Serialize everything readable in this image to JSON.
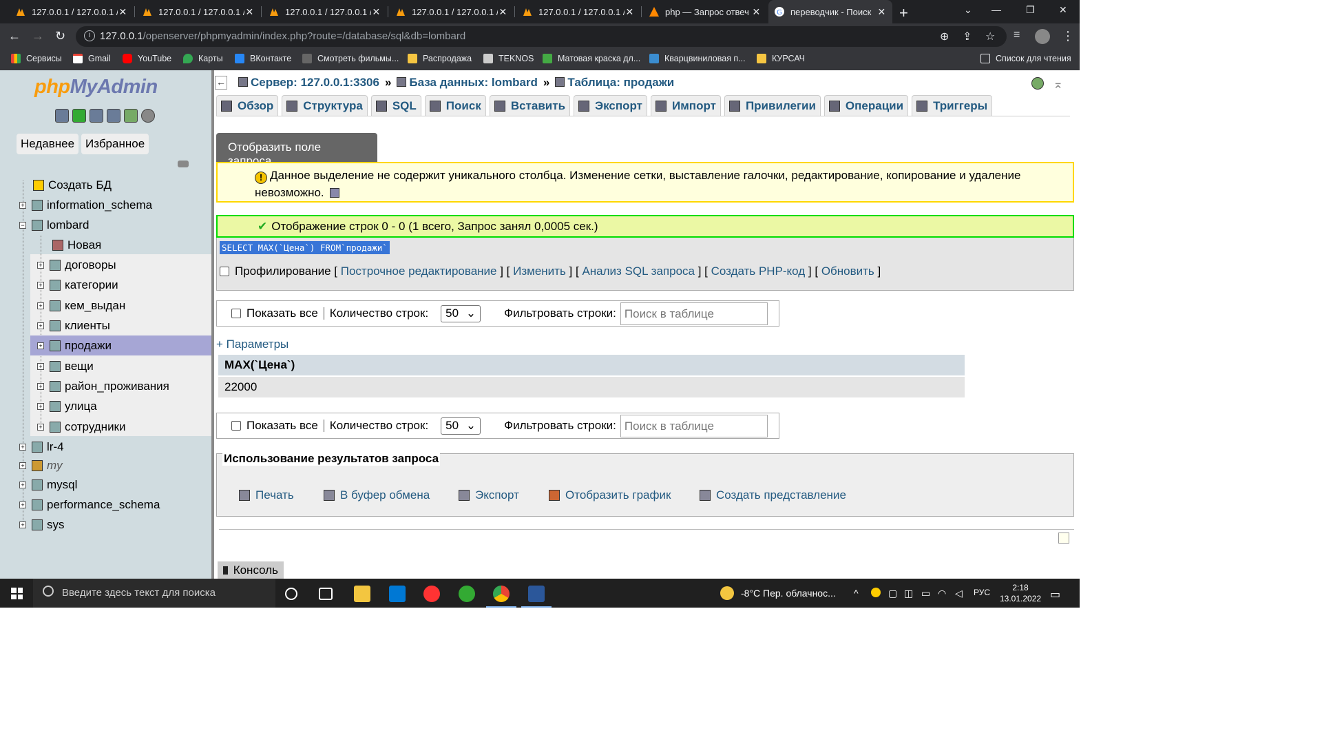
{
  "browser": {
    "tabs": [
      {
        "title": "127.0.0.1 / 127.0.0.1 /",
        "close": "✕"
      },
      {
        "title": "127.0.0.1 / 127.0.0.1 /",
        "close": "✕"
      },
      {
        "title": "127.0.0.1 / 127.0.0.1 /",
        "close": "✕"
      },
      {
        "title": "127.0.0.1 / 127.0.0.1 /",
        "close": "✕"
      },
      {
        "title": "127.0.0.1 / 127.0.0.1 /",
        "close": "✕"
      },
      {
        "title": "php — Запрос отвеч",
        "close": "✕"
      },
      {
        "title": "переводчик - Поиск",
        "close": "✕"
      }
    ],
    "new_tab": "+",
    "url_host": "127.0.0.1",
    "url_path": "/openserver/phpmyadmin/index.php?route=/database/sql&db=lombard",
    "bookmarks": [
      "Сервисы",
      "Gmail",
      "YouTube",
      "Карты",
      "ВКонтакте",
      "Смотреть фильмы...",
      "Распродажа",
      "TEKNOS",
      "Матовая краска дл...",
      "Кварцвиниловая п...",
      "КУРСАЧ"
    ],
    "reading_list": "Список для чтения"
  },
  "sidebar": {
    "logo_php": "php",
    "logo_admin": "MyAdmin",
    "recent": "Недавнее",
    "favorites": "Избранное",
    "create_db": "Создать БД",
    "databases": [
      "information_schema",
      "lombard",
      "lr-4",
      "my",
      "mysql",
      "performance_schema",
      "sys"
    ],
    "lombard_new": "Новая",
    "lombard_tables": [
      "договоры",
      "категории",
      "кем_выдан",
      "клиенты",
      "продажи",
      "вещи",
      "район_проживания",
      "улица",
      "сотрудники"
    ]
  },
  "breadcrumb": {
    "server": "Сервер: 127.0.0.1:3306",
    "database": "База данных: lombard",
    "table": "Таблица: продажи",
    "sep": "»"
  },
  "tabs": [
    "Обзор",
    "Структура",
    "SQL",
    "Поиск",
    "Вставить",
    "Экспорт",
    "Импорт",
    "Привилегии",
    "Операции",
    "Триггеры"
  ],
  "show_query_button": "Отобразить поле запроса",
  "notice": {
    "text": "Данное выделение не содержит уникального столбца. Изменение сетки, выставление галочки, редактирование, копирование и удаление невозможно."
  },
  "success": {
    "text": "Отображение строк 0 - 0 (1 всего, Запрос занял 0,0005 сек.)"
  },
  "sql": {
    "query": "SELECT MAX(`Цена`) FROM`продажи`",
    "profiling": "Профилирование",
    "links": [
      "Построчное редактирование",
      "Изменить",
      "Анализ SQL запроса",
      "Создать PHP-код",
      "Обновить"
    ]
  },
  "nav": {
    "show_all": "Показать все",
    "rows_label": "Количество строк:",
    "rows_value": "50",
    "filter_label": "Фильтровать строки:",
    "filter_placeholder": "Поиск в таблице"
  },
  "params_link": "+ Параметры",
  "result": {
    "column": "MAX(`Цена`)",
    "value": "22000"
  },
  "query_results_ops": {
    "legend": "Использование результатов запроса",
    "items": [
      "Печать",
      "В буфер обмена",
      "Экспорт",
      "Отобразить график",
      "Создать представление"
    ]
  },
  "console": "Консоль",
  "taskbar": {
    "search_placeholder": "Введите здесь текст для поиска",
    "weather": "-8°C  Пер. облачнос...",
    "lang": "РУС",
    "time": "2:18",
    "date": "13.01.2022"
  }
}
